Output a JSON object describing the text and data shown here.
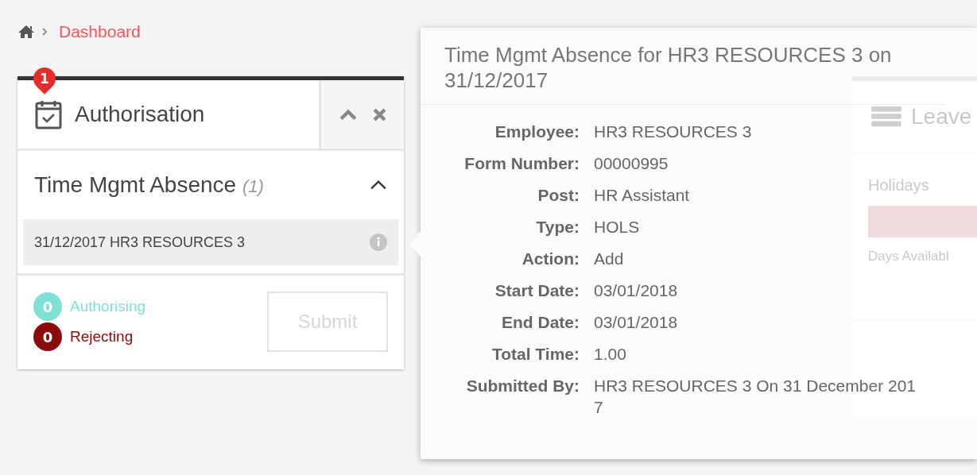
{
  "breadcrumb": {
    "current": "Dashboard"
  },
  "widget": {
    "title": "Authorisation",
    "badge": "1",
    "section": {
      "title": "Time Mgmt Absence",
      "count": "(1)",
      "expanded": true,
      "items": [
        {
          "label": "31/12/2017 HR3 RESOURCES 3",
          "selected": true
        }
      ]
    },
    "counters": [
      {
        "count": "0",
        "label": "Authorising",
        "color": "#7fe0d6"
      },
      {
        "count": "0",
        "label": "Rejecting",
        "color": "#8b0a0a"
      }
    ],
    "submit": {
      "label": "Submit",
      "disabled": true
    }
  },
  "leave_widget": {
    "title": "Leave",
    "category": "Holidays",
    "note": "Days Availabl"
  },
  "popover": {
    "title": "Time Mgmt Absence for HR3 RESOURCES 3 on 31/12/2017",
    "fields": [
      {
        "label": "Employee:",
        "value": "HR3 RESOURCES 3"
      },
      {
        "label": "Form Number:",
        "value": "00000995"
      },
      {
        "label": "Post:",
        "value": "HR Assistant"
      },
      {
        "label": "Type:",
        "value": "HOLS"
      },
      {
        "label": "Action:",
        "value": "Add"
      },
      {
        "label": "Start Date:",
        "value": "03/01/2018"
      },
      {
        "label": "End Date:",
        "value": "03/01/2018"
      },
      {
        "label": "Total Time:",
        "value": "1.00"
      },
      {
        "label": "Submitted By:",
        "value": "HR3 RESOURCES 3 On 31 December 2017"
      }
    ]
  }
}
